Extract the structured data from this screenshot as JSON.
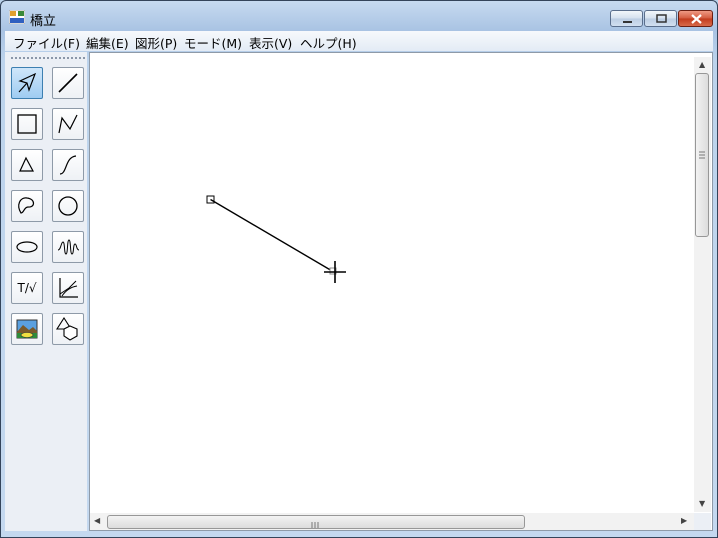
{
  "window": {
    "title": "橋立",
    "buttons": {
      "minimize": "minimize-icon",
      "maximize": "maximize-icon",
      "close": "close-icon"
    }
  },
  "menu": [
    {
      "label": "ファイル(F)"
    },
    {
      "label": "編集(E)"
    },
    {
      "label": "図形(P)"
    },
    {
      "label": "モード(M)"
    },
    {
      "label": "表示(V)"
    },
    {
      "label": "ヘルプ(H)"
    }
  ],
  "toolbox": {
    "tools": [
      {
        "name": "select-tool",
        "icon": "arrow-icon",
        "active": true
      },
      {
        "name": "line-tool",
        "icon": "line-icon"
      },
      {
        "name": "rectangle-tool",
        "icon": "rectangle-icon"
      },
      {
        "name": "polyline-tool",
        "icon": "polyline-icon"
      },
      {
        "name": "polygon-tool",
        "icon": "triangle-icon"
      },
      {
        "name": "curve-tool",
        "icon": "curve-icon"
      },
      {
        "name": "closed-curve-tool",
        "icon": "closed-curve-icon"
      },
      {
        "name": "circle-tool",
        "icon": "circle-icon"
      },
      {
        "name": "ellipse-tool",
        "icon": "ellipse-icon"
      },
      {
        "name": "wave-tool",
        "icon": "wave-icon"
      },
      {
        "name": "text-math-tool",
        "icon": "text-icon",
        "label": "T/√"
      },
      {
        "name": "graph-tool",
        "icon": "graph-icon"
      },
      {
        "name": "image-tool",
        "icon": "picture-icon"
      },
      {
        "name": "shapes-tool",
        "icon": "shapes-icon"
      }
    ]
  },
  "colors": {
    "accent": "#3c7fb1",
    "canvas": "#ffffff",
    "close": "#c23a1c"
  }
}
